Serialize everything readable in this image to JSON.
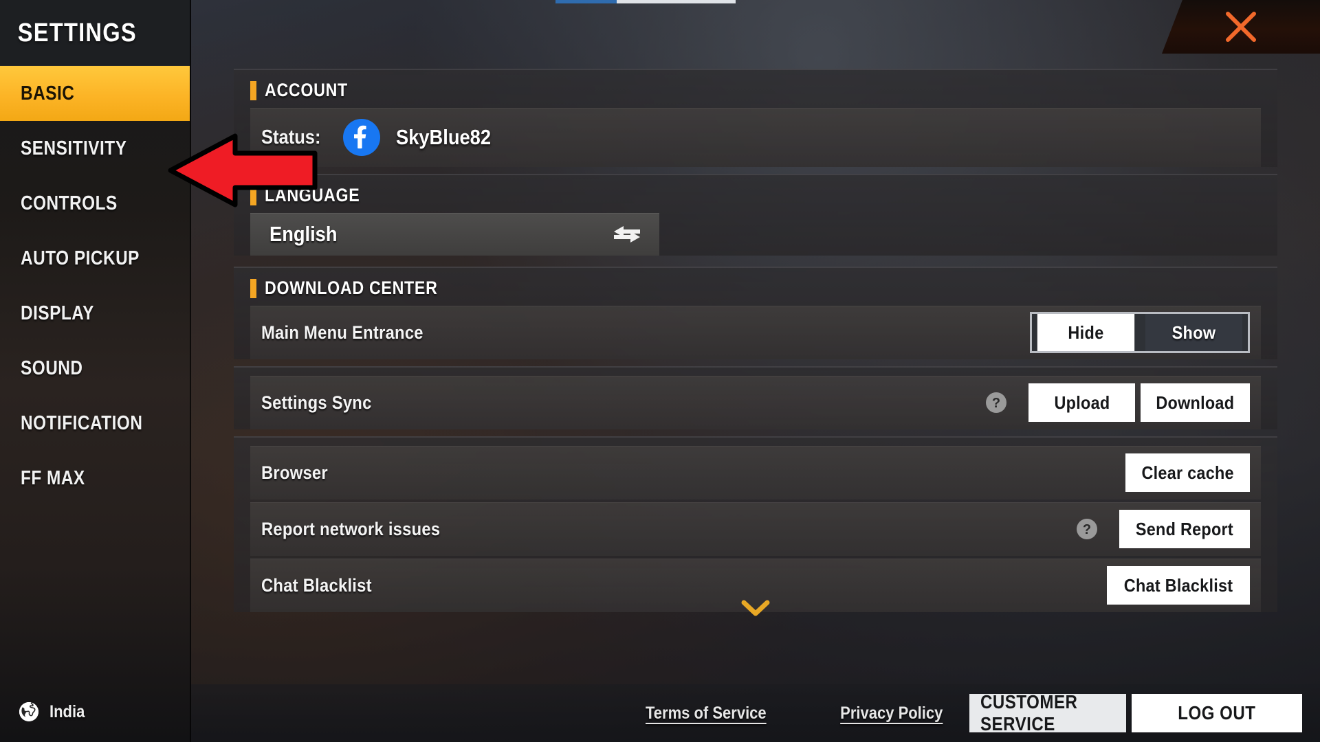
{
  "window": {
    "title": "SETTINGS",
    "close_icon": "close-x-icon",
    "accent_color": "#f5a623",
    "active_tab_color": "#fcb426"
  },
  "sidebar": {
    "title": "SETTINGS",
    "items": [
      {
        "label": "BASIC",
        "active": true
      },
      {
        "label": "SENSITIVITY",
        "active": false
      },
      {
        "label": "CONTROLS",
        "active": false
      },
      {
        "label": "AUTO PICKUP",
        "active": false
      },
      {
        "label": "DISPLAY",
        "active": false
      },
      {
        "label": "SOUND",
        "active": false
      },
      {
        "label": "NOTIFICATION",
        "active": false
      },
      {
        "label": "FF MAX",
        "active": false
      }
    ],
    "region": {
      "icon": "globe-icon",
      "label": "India"
    }
  },
  "sections": {
    "account": {
      "title": "ACCOUNT",
      "status_label": "Status:",
      "provider_icon": "facebook-icon",
      "username": "SkyBlue82"
    },
    "language": {
      "title": "LANGUAGE",
      "value": "English",
      "swap_icon": "swap-arrows-icon"
    },
    "download_center": {
      "title": "DOWNLOAD CENTER",
      "rows": [
        {
          "label": "Main Menu Entrance",
          "control": "segmented",
          "options": [
            "Hide",
            "Show"
          ],
          "selected": "Hide"
        },
        {
          "label": "Settings Sync",
          "control": "buttons",
          "help_icon": "question-mark-icon",
          "has_help": true,
          "buttons": [
            "Upload",
            "Download"
          ]
        },
        {
          "label": "Browser",
          "control": "buttons",
          "has_help": false,
          "buttons": [
            "Clear cache"
          ]
        },
        {
          "label": "Report network issues",
          "control": "buttons",
          "help_icon": "question-mark-icon",
          "has_help": true,
          "buttons": [
            "Send Report"
          ]
        },
        {
          "label": "Chat Blacklist",
          "control": "buttons",
          "has_help": false,
          "buttons": [
            "Chat Blacklist"
          ]
        }
      ]
    }
  },
  "scroll_indicator": {
    "icon": "chevron-down-icon",
    "color": "#e8a825"
  },
  "footer": {
    "terms_label": "Terms of Service",
    "privacy_label": "Privacy Policy",
    "customer_service_label": "CUSTOMER SERVICE",
    "logout_label": "LOG OUT"
  },
  "annotation": {
    "arrow_icon": "red-left-arrow-annotation",
    "fill": "#ef1c25",
    "stroke": "#000000"
  }
}
